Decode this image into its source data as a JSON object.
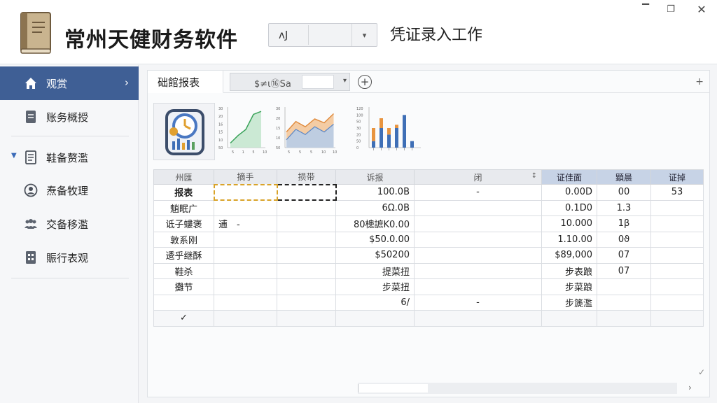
{
  "app": {
    "title": "常州天健财务软件",
    "module": "凭证录入工作"
  },
  "header_combo": {
    "value": "ᴧJ",
    "arrow": "▾"
  },
  "window": {
    "minimize": "▔",
    "maximize": "❐",
    "close": "✕"
  },
  "sidebar": {
    "items": [
      {
        "label": "观赏",
        "icon": "home-icon",
        "active": true,
        "chevron": "›"
      },
      {
        "label": "账务概授",
        "icon": "document-icon"
      },
      {
        "label": "鞋备赘濫",
        "icon": "list-icon",
        "caret": "▼"
      },
      {
        "label": "焘备牧理",
        "icon": "person-icon"
      },
      {
        "label": "交备移濫",
        "icon": "group-icon"
      },
      {
        "label": "賑行表观",
        "icon": "report-icon"
      }
    ]
  },
  "tabs": {
    "active_label": "础館报表",
    "combo_text": "$≠ι⑯Sa",
    "add": "+",
    "panel_plus": "+"
  },
  "mini_charts": [
    {
      "type": "line",
      "ticks": [
        "30",
        "20",
        "16",
        "15",
        "10",
        "50"
      ],
      "x_ticks": [
        "5",
        "1",
        "5",
        "10"
      ],
      "values": [
        3,
        8,
        12,
        22,
        24
      ]
    },
    {
      "type": "area",
      "ticks": [
        "30",
        "20",
        "15",
        "10",
        "50"
      ],
      "x_ticks": [
        "5",
        "5",
        "5",
        "10",
        "10"
      ],
      "values_top": [
        12,
        20,
        16,
        22,
        19,
        26
      ],
      "values_bottom": [
        6,
        14,
        10,
        16,
        12,
        18
      ]
    },
    {
      "type": "bar",
      "ticks": [
        "120",
        "100",
        "50",
        "30",
        "20",
        "50",
        "0"
      ],
      "values_blue": [
        20,
        60,
        40,
        60,
        100,
        20
      ],
      "values_orange": [
        40,
        30,
        20,
        10,
        0,
        0
      ]
    }
  ],
  "grid": {
    "headers": [
      "州匯",
      "摘手",
      "损带",
      "诉报",
      "闭",
      "证佳面",
      "顕晨",
      "证掉"
    ],
    "sort_icon": "↕",
    "rows": [
      [
        "报表",
        "",
        "",
        "100.0B",
        "-",
        "0.00D",
        "00",
        "53"
      ],
      [
        "魈眠广",
        "",
        "",
        "6Ω.0B",
        "",
        "0.1D0",
        "1.3",
        ""
      ],
      [
        "诋子螻褒",
        "逋　-",
        "",
        "80槵謶K0.00",
        "",
        "10.000",
        "1β",
        ""
      ],
      [
        "敦系刚",
        "",
        "",
        "$50.0.00",
        "",
        "1.10.00",
        "0ϑ",
        ""
      ],
      [
        "逶乎继酥",
        "",
        "",
        "$50200",
        "",
        "$89,000",
        "07",
        ""
      ],
      [
        "鞋杀",
        "",
        "",
        "提菜扭",
        "",
        "步表踉",
        "07",
        ""
      ],
      [
        "攤节",
        "",
        "",
        "步菜扭",
        "",
        "步菜踉",
        "",
        ""
      ],
      [
        "",
        "",
        "",
        "6/",
        "-",
        "步篪濫",
        "",
        ""
      ],
      [
        "✓",
        "",
        "",
        "",
        "",
        "",
        "",
        ""
      ]
    ]
  },
  "scroll": {
    "right_arrow": "›",
    "corner": "✓"
  }
}
